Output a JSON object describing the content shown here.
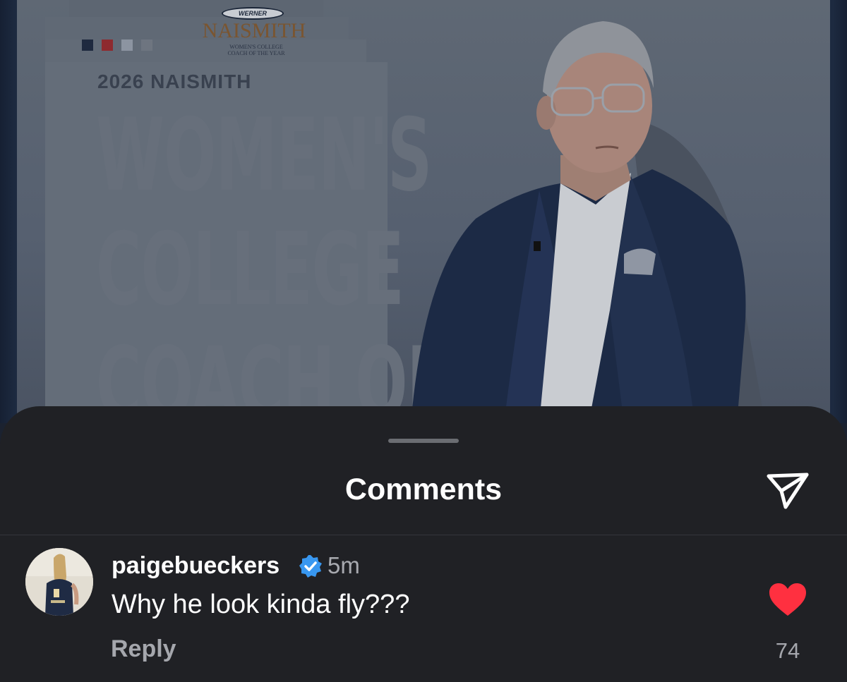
{
  "post": {
    "logo_brand": "WERNER",
    "logo_name": "NAISMITH",
    "logo_subtitle_line1": "WOMEN'S COLLEGE",
    "logo_subtitle_line2": "COACH OF THE YEAR",
    "heading_small": "2026 NAISMITH",
    "heading_line1": "WOMEN'S",
    "heading_line2": "COLLEGE",
    "heading_line3": "COACH OF",
    "swatch_colors": [
      "#1f2a3f",
      "#8e2a2f",
      "#8c94a1",
      "#6e7580"
    ]
  },
  "sheet": {
    "title": "Comments",
    "share_icon": "send-icon"
  },
  "comment": {
    "username": "paigebueckers",
    "verified_icon": "verified-badge-icon",
    "timestamp": "5m",
    "text": "Why he look kinda fly???",
    "reply_label": "Reply",
    "like_icon": "heart-icon",
    "like_count": "74",
    "like_color": "#ff3040"
  }
}
